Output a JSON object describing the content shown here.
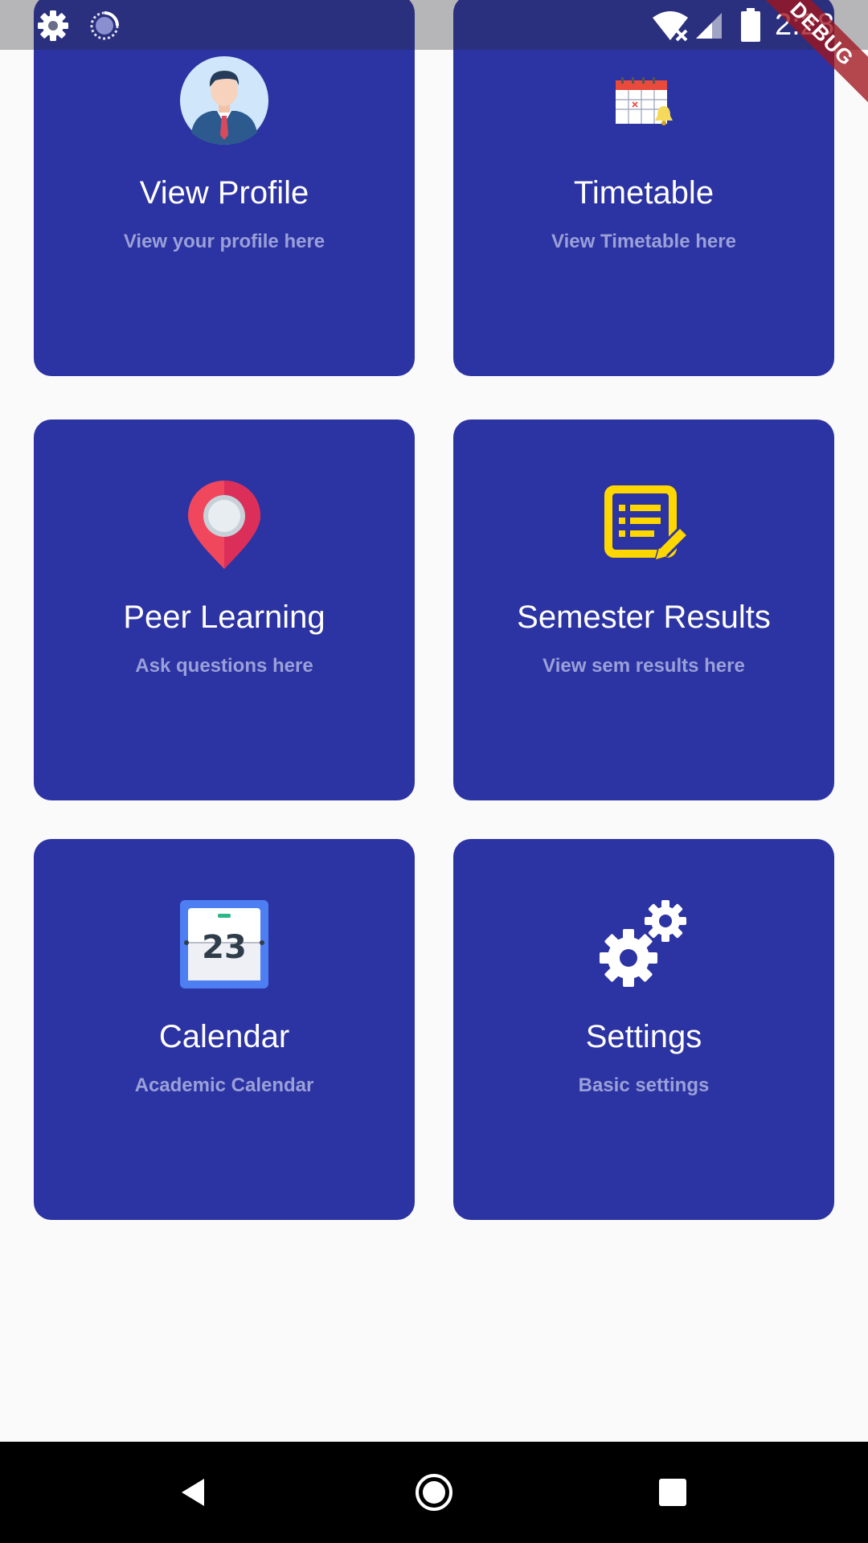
{
  "status_bar": {
    "time": "2:28",
    "debug_label": "DEBUG",
    "icons": [
      "settings-gear-icon",
      "sync-spinner-icon",
      "wifi-off-icon",
      "cell-signal-icon",
      "battery-icon"
    ]
  },
  "cards": [
    {
      "title": "View Profile",
      "subtitle": "View your profile here",
      "icon": "profile-avatar-icon"
    },
    {
      "title": "Timetable",
      "subtitle": "View Timetable here",
      "icon": "timetable-calendar-icon"
    },
    {
      "title": "Peer Learning",
      "subtitle": "Ask questions here",
      "icon": "map-pin-icon"
    },
    {
      "title": "Semester Results",
      "subtitle": "View sem results here",
      "icon": "results-document-icon"
    },
    {
      "title": "Calendar",
      "subtitle": "Academic Calendar",
      "icon": "calendar-date-icon",
      "icon_text": "23"
    },
    {
      "title": "Settings",
      "subtitle": "Basic settings",
      "icon": "settings-gears-icon"
    }
  ],
  "nav_bar": {
    "buttons": [
      "back-icon",
      "home-icon",
      "recents-icon"
    ]
  },
  "colors": {
    "card_background": "#2c33a2",
    "card_title": "#ffffff",
    "card_subtitle": "#9aa0d8",
    "page_background": "#fafafa",
    "nav_background": "#000000"
  }
}
